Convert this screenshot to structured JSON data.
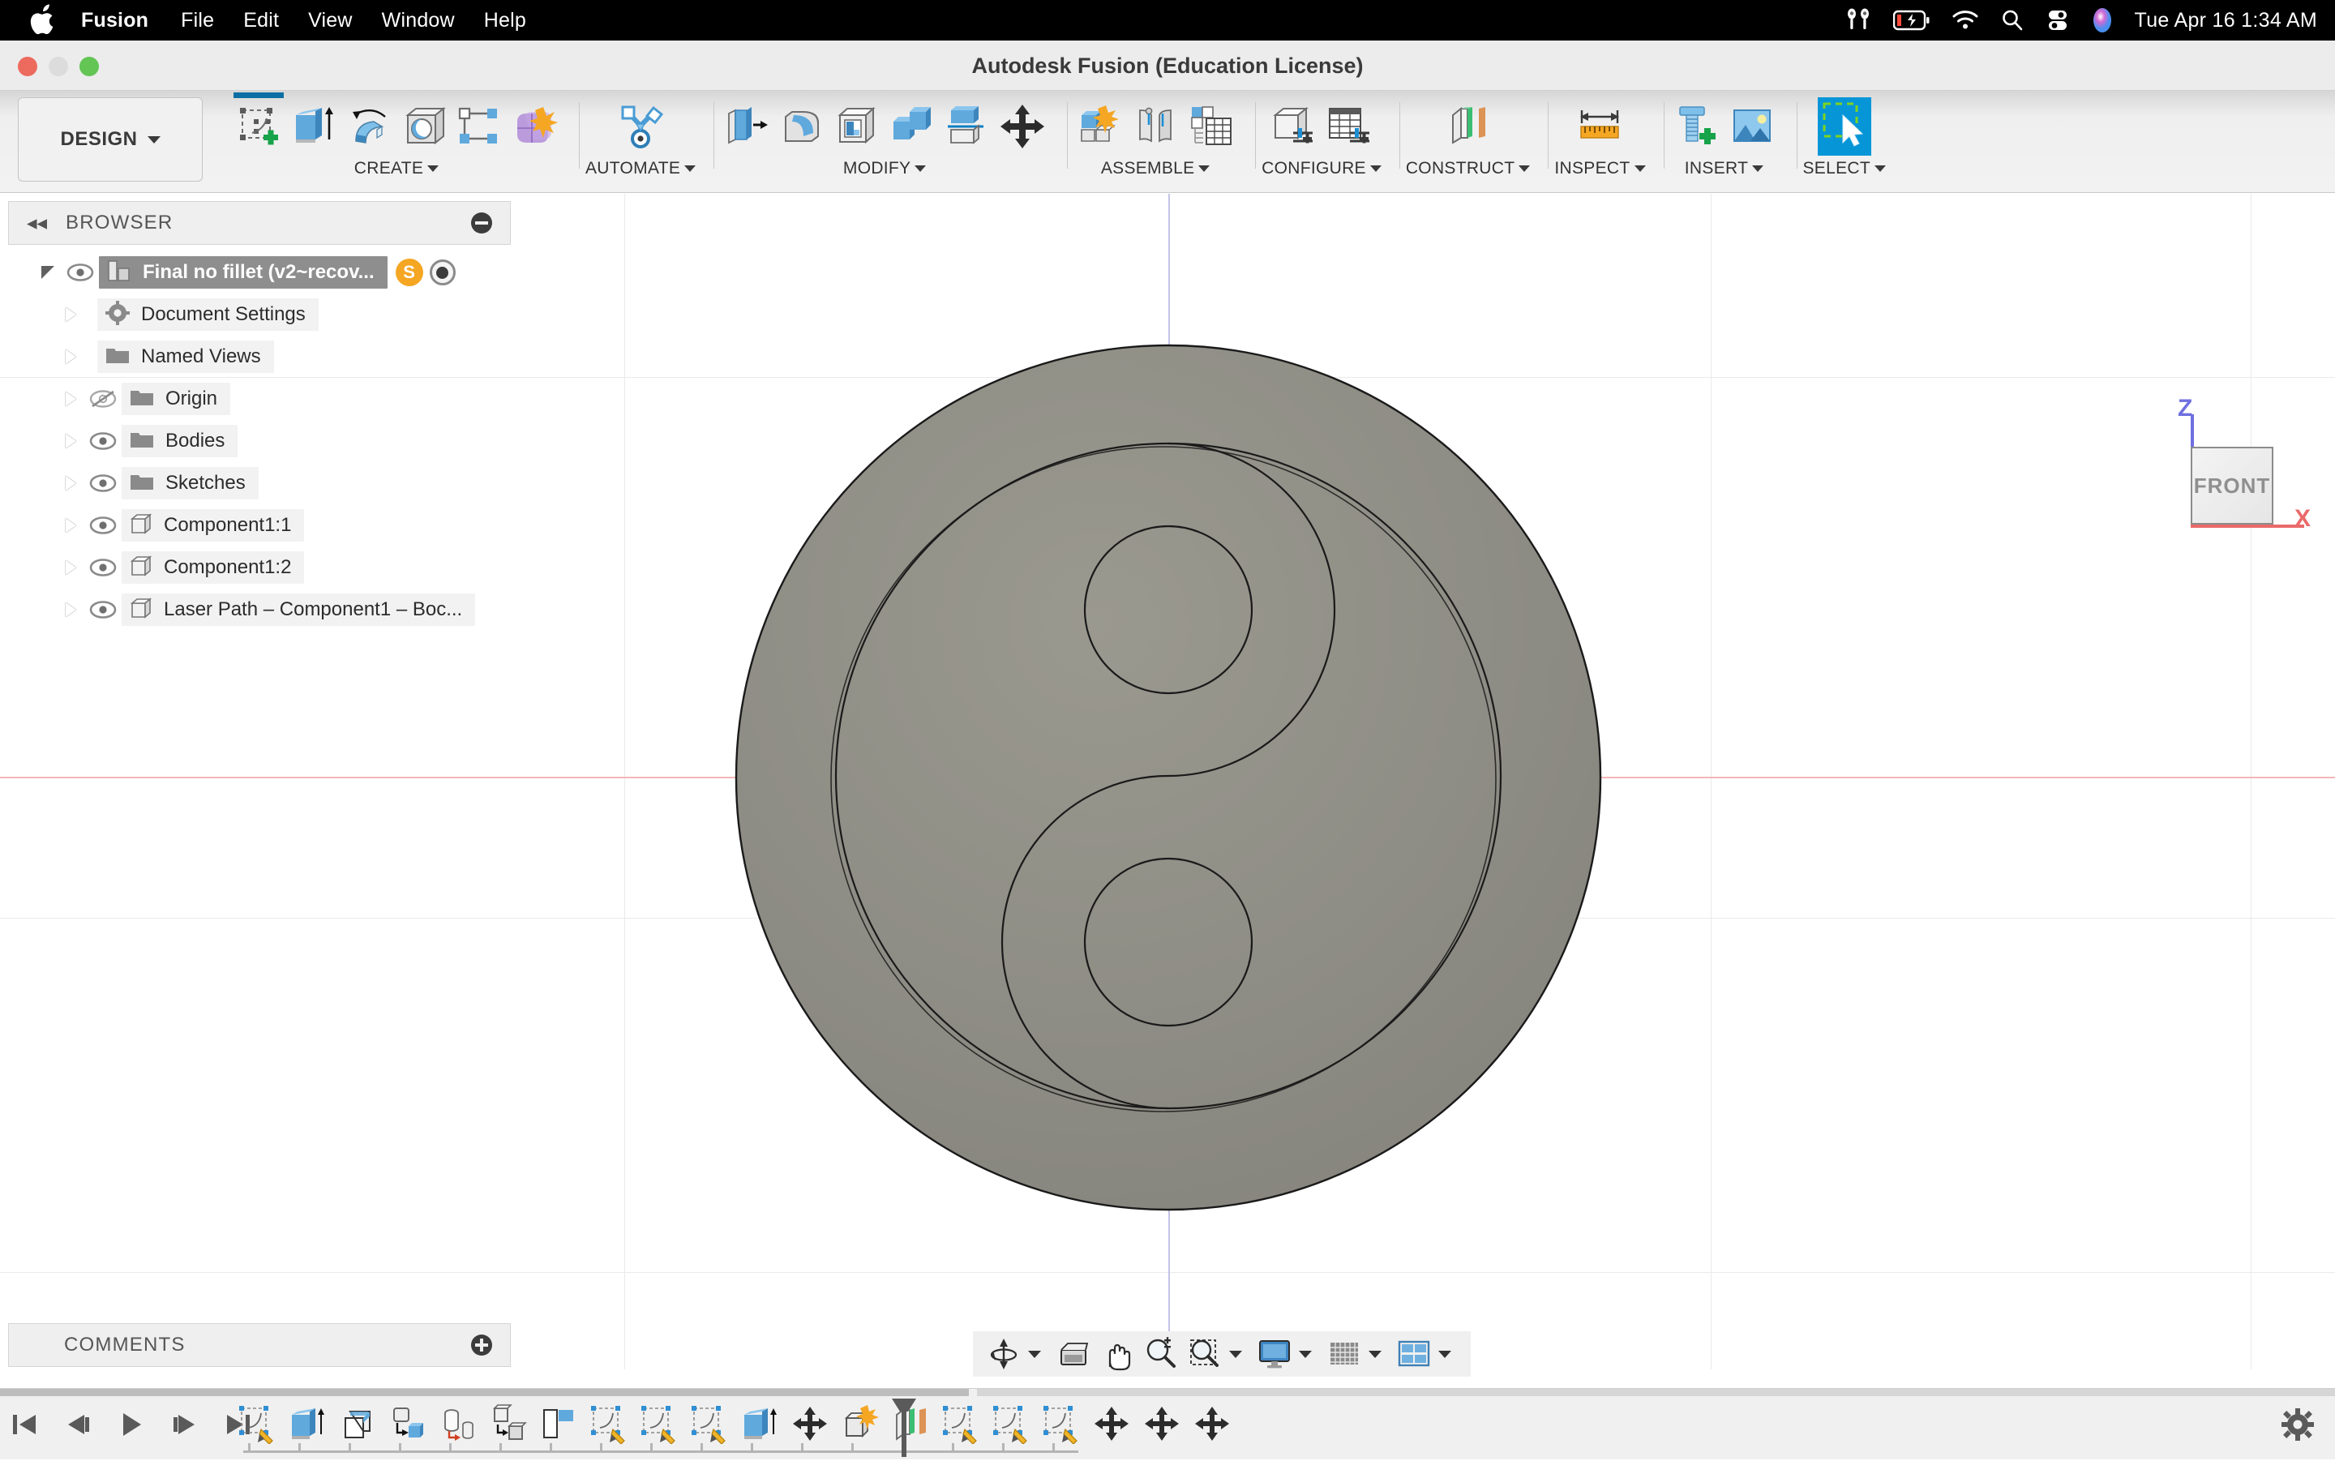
{
  "macbar": {
    "apple_icon": "apple-logo-icon",
    "items": [
      {
        "label": "Fusion",
        "bold": true
      },
      {
        "label": "File",
        "bold": false
      },
      {
        "label": "Edit",
        "bold": false
      },
      {
        "label": "View",
        "bold": false
      },
      {
        "label": "Window",
        "bold": false
      },
      {
        "label": "Help",
        "bold": false
      }
    ],
    "status_icons": [
      "airpods-icon",
      "battery-charging-icon",
      "wifi-icon",
      "search-icon",
      "control-center-icon",
      "siri-icon"
    ],
    "clock": "Tue Apr 16  1:34 AM"
  },
  "window": {
    "title": "Autodesk Fusion (Education License)",
    "traffic_lights": [
      "close-button",
      "minimize-button",
      "maximize-button"
    ]
  },
  "ribbon": {
    "workspace": "DESIGN",
    "groups": [
      {
        "label": "CREATE",
        "buttons": [
          {
            "name": "create-sketch-button",
            "active": false,
            "selected_bar": true
          },
          {
            "name": "extrude-button",
            "active": false,
            "selected_bar": false
          },
          {
            "name": "revolve-button",
            "active": false,
            "selected_bar": false
          },
          {
            "name": "hole-button",
            "active": false,
            "selected_bar": false
          },
          {
            "name": "pattern-button",
            "active": false,
            "selected_bar": false
          },
          {
            "name": "form-create-button",
            "active": false,
            "selected_bar": false
          }
        ]
      },
      {
        "label": "AUTOMATE",
        "buttons": [
          {
            "name": "automated-modeling-button",
            "active": false,
            "selected_bar": false
          }
        ]
      },
      {
        "label": "MODIFY",
        "buttons": [
          {
            "name": "press-pull-button",
            "active": false,
            "selected_bar": false
          },
          {
            "name": "fillet-button",
            "active": false,
            "selected_bar": false
          },
          {
            "name": "shell-button",
            "active": false,
            "selected_bar": false
          },
          {
            "name": "combine-button",
            "active": false,
            "selected_bar": false
          },
          {
            "name": "split-face-button",
            "active": false,
            "selected_bar": false
          },
          {
            "name": "move-copy-button",
            "active": false,
            "selected_bar": false
          }
        ]
      },
      {
        "label": "ASSEMBLE",
        "buttons": [
          {
            "name": "new-component-button",
            "active": false,
            "selected_bar": false
          },
          {
            "name": "joint-button",
            "active": false,
            "selected_bar": false
          },
          {
            "name": "bom-button",
            "active": false,
            "selected_bar": false
          }
        ]
      },
      {
        "label": "CONFIGURE",
        "buttons": [
          {
            "name": "configure-design-button",
            "active": false,
            "selected_bar": false
          },
          {
            "name": "configuration-table-button",
            "active": false,
            "selected_bar": false
          }
        ]
      },
      {
        "label": "CONSTRUCT",
        "buttons": [
          {
            "name": "offset-plane-button",
            "active": false,
            "selected_bar": false
          }
        ]
      },
      {
        "label": "INSPECT",
        "buttons": [
          {
            "name": "measure-button",
            "active": false,
            "selected_bar": false
          }
        ]
      },
      {
        "label": "INSERT",
        "buttons": [
          {
            "name": "insert-mcmaster-button",
            "active": false,
            "selected_bar": false
          },
          {
            "name": "insert-canvas-button",
            "active": false,
            "selected_bar": false
          }
        ]
      },
      {
        "label": "SELECT",
        "buttons": [
          {
            "name": "select-tool-button",
            "active": true,
            "selected_bar": false
          }
        ]
      }
    ]
  },
  "browser": {
    "title": "BROWSER",
    "collapse_icon": "collapse-left-icon",
    "minimize_icon": "minimize-icon",
    "tree": [
      {
        "label": "Final no fillet (v2~recov...",
        "icon": "assembly-icon",
        "eye": "visible",
        "selected": true,
        "expander": "down",
        "indent": 0,
        "badge": "S",
        "radio": true
      },
      {
        "label": "Document Settings",
        "icon": "gear-icon",
        "eye": "none",
        "selected": false,
        "expander": "right",
        "indent": 1
      },
      {
        "label": "Named Views",
        "icon": "folder-icon",
        "eye": "none",
        "selected": false,
        "expander": "right",
        "indent": 1
      },
      {
        "label": "Origin",
        "icon": "folder-icon",
        "eye": "hidden",
        "selected": false,
        "expander": "right",
        "indent": 1
      },
      {
        "label": "Bodies",
        "icon": "folder-icon",
        "eye": "visible",
        "selected": false,
        "expander": "right",
        "indent": 1
      },
      {
        "label": "Sketches",
        "icon": "folder-icon",
        "eye": "visible",
        "selected": false,
        "expander": "right",
        "indent": 1
      },
      {
        "label": "Component1:1",
        "icon": "component-icon",
        "eye": "visible",
        "selected": false,
        "expander": "right",
        "indent": 1
      },
      {
        "label": "Component1:2",
        "icon": "component-icon",
        "eye": "visible",
        "selected": false,
        "expander": "right",
        "indent": 1
      },
      {
        "label": "Laser Path – Component1 – Boc...",
        "icon": "component-icon",
        "eye": "visible",
        "selected": false,
        "expander": "right",
        "indent": 1
      }
    ]
  },
  "comments": {
    "title": "COMMENTS",
    "add_icon": "add-comment-icon"
  },
  "viewcube": {
    "face_label": "FRONT",
    "axis_z": "Z",
    "axis_x": "X",
    "z_color": "#6f6fe0",
    "x_color": "#ea6a6a"
  },
  "navbar": {
    "buttons": [
      {
        "name": "orbit-button",
        "caret": true
      },
      {
        "name": "look-at-button",
        "caret": false
      },
      {
        "name": "pan-button",
        "caret": false
      },
      {
        "name": "zoom-button",
        "caret": false
      },
      {
        "name": "zoom-window-button",
        "caret": true
      },
      {
        "name": "display-settings-button",
        "caret": true
      },
      {
        "name": "grid-snaps-button",
        "caret": true
      },
      {
        "name": "viewports-button",
        "caret": true
      }
    ]
  },
  "timeline": {
    "playback": [
      "go-to-beginning-button",
      "step-back-button",
      "play-button",
      "step-forward-button",
      "go-to-end-button"
    ],
    "features": [
      "sketch-feature",
      "extrude-feature",
      "offset-feature",
      "move-copy-feature",
      "revolve-feature",
      "copy-paste-feature",
      "plane-feature",
      "sketch-feature",
      "sketch-feature",
      "sketch-feature",
      "extrude-feature",
      "move-feature",
      "new-component-feature",
      "construct-plane-feature",
      "sketch-feature",
      "sketch-feature",
      "sketch-feature",
      "move-feature",
      "move-feature",
      "move-feature"
    ],
    "marker": "timeline-marker",
    "settings_icon": "gear-icon"
  },
  "model": {
    "name": "yin-yang-disc-model",
    "body_fill": "#8e8d85",
    "edge_color": "#1a1a1a",
    "view": "FRONT"
  }
}
